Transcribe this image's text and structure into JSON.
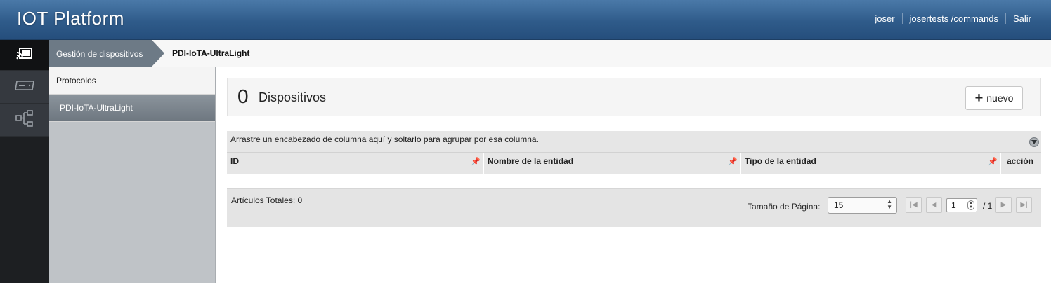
{
  "app": {
    "title": "IOT Platform"
  },
  "topnav": {
    "user": "joser",
    "service": "josertests /commands",
    "logout": "Salir"
  },
  "rail": {
    "items": [
      {
        "icon": "cast-icon"
      },
      {
        "icon": "device-icon"
      },
      {
        "icon": "network-icon"
      }
    ]
  },
  "breadcrumb": {
    "parent": "Gestión de dispositivos",
    "current": "PDI-IoTA-UltraLight"
  },
  "sidebar": {
    "items": [
      {
        "label": "Protocolos"
      },
      {
        "label": "PDI-IoTA-UltraLight"
      }
    ]
  },
  "panel": {
    "count": "0",
    "title": "Dispositivos",
    "new_button": "nuevo"
  },
  "grid": {
    "group_hint": "Arrastre un encabezado de columna aquí y soltarlo para agrupar por esa columna.",
    "columns": [
      "ID",
      "Nombre de la entidad",
      "Tipo de la entidad",
      "acción"
    ],
    "rows": []
  },
  "pager": {
    "totals": "Artículos Totales: 0",
    "page_size_label": "Tamaño de Página:",
    "page_size": "15",
    "page": "1",
    "of_pages": "/ 1"
  }
}
